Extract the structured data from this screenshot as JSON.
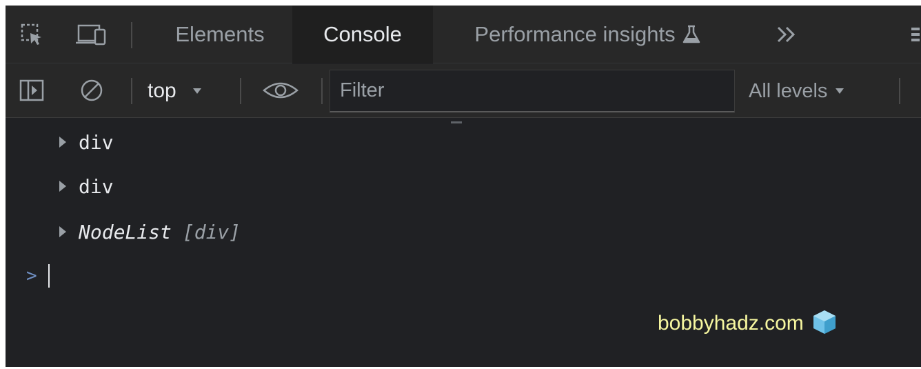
{
  "tabbar": {
    "tabs": [
      {
        "label": "Elements",
        "active": false
      },
      {
        "label": "Console",
        "active": true
      },
      {
        "label": "Performance insights",
        "active": false
      }
    ],
    "icons": [
      "inspect-element-icon",
      "device-toolbar-icon",
      "flask-icon",
      "more-tabs-icon",
      "settings-menu-icon"
    ]
  },
  "toolbar": {
    "context": "top",
    "filter_placeholder": "Filter",
    "filter_value": "",
    "levels_label": "All levels",
    "icons": [
      "sidebar-toggle-icon",
      "clear-console-icon",
      "live-expression-eye-icon"
    ]
  },
  "console": {
    "lines": [
      {
        "text": "div"
      },
      {
        "text": "div"
      },
      {
        "label": "NodeList",
        "detail": "[div]"
      }
    ],
    "prompt_symbol": ">"
  },
  "watermark": {
    "text": "bobbyhadz.com"
  },
  "colors": {
    "background": "#202124",
    "toolbar": "#282828",
    "text": "#e8eaed",
    "muted": "#9aa0a6",
    "watermark": "#f7f7a0",
    "logo": "#6fc2e8"
  }
}
